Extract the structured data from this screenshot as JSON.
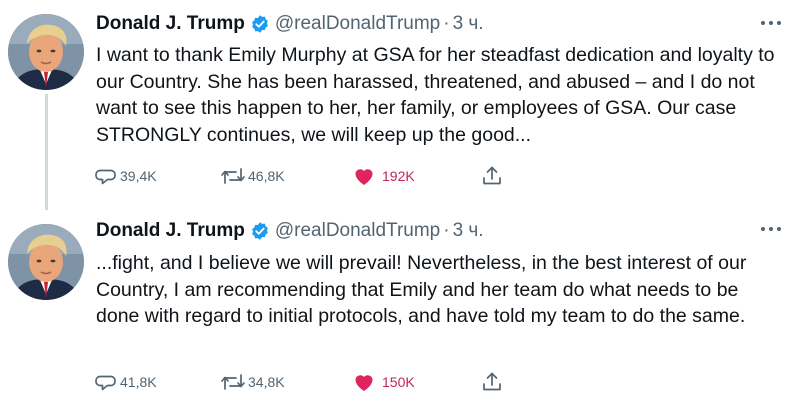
{
  "colors": {
    "verified_badge": "#1d9bf0",
    "like_heart": "#e0245e",
    "like_count": "#c0275a",
    "muted_text": "#536471",
    "thread_line": "#cfd9de"
  },
  "tweets": [
    {
      "author_name": "Donald J. Trump",
      "handle": "@realDonaldTrump",
      "separator": "·",
      "time": "3 ч.",
      "text": "I want to thank Emily Murphy at GSA for her steadfast dedication and loyalty to our Country. She has been harassed, threatened, and abused – and I do not want to see this happen to her, her family, or employees of GSA. Our case STRONGLY continues, we will keep up the good...",
      "replies": "39,4K",
      "retweets": "46,8K",
      "likes": "192K",
      "liked": true,
      "icons": [
        "verified-badge-icon",
        "more-icon",
        "reply-icon",
        "retweet-icon",
        "like-heart-icon",
        "share-icon"
      ]
    },
    {
      "author_name": "Donald J. Trump",
      "handle": "@realDonaldTrump",
      "separator": "·",
      "time": "3 ч.",
      "text": "...fight, and I believe we will prevail! Nevertheless, in the best interest of our Country, I am recommending that Emily and her team do what needs to be done with regard to initial protocols, and have told my team to do the same.",
      "replies": "41,8K",
      "retweets": "34,8K",
      "likes": "150K",
      "liked": true,
      "icons": [
        "verified-badge-icon",
        "more-icon",
        "reply-icon",
        "retweet-icon",
        "like-heart-icon",
        "share-icon"
      ]
    }
  ]
}
